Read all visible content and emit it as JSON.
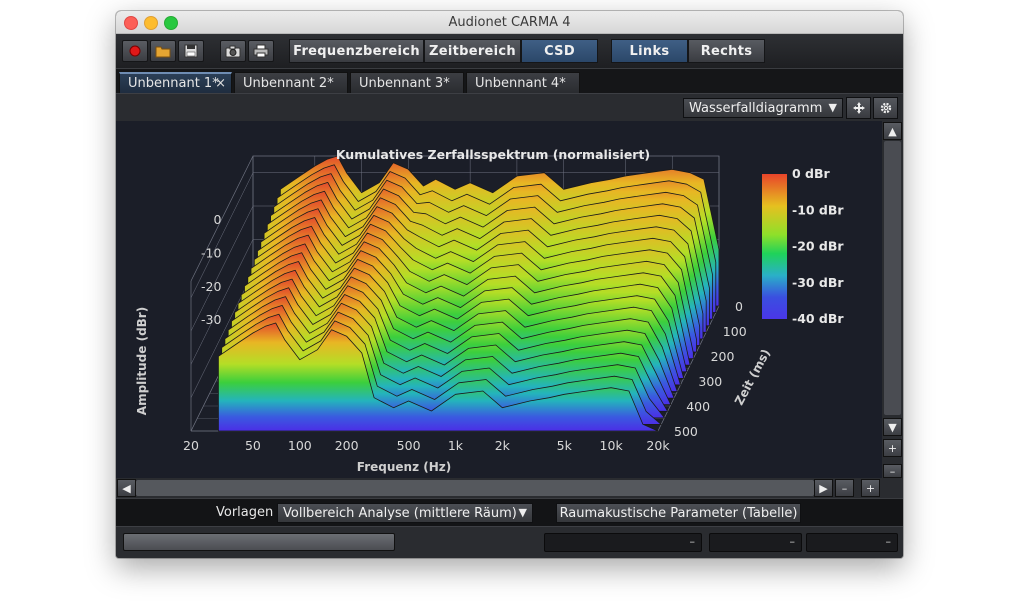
{
  "window": {
    "title": "Audionet CARMA 4"
  },
  "toolbar": {
    "icons": [
      "record-icon",
      "open-folder-icon",
      "save-icon",
      "camera-icon",
      "print-icon"
    ],
    "views": [
      "Frequenzbereich",
      "Zeitbereich",
      "CSD"
    ],
    "active_view": "CSD",
    "channels": [
      "Links",
      "Rechts"
    ],
    "active_channel": "Links",
    "accent": "#2b4769"
  },
  "tabs": [
    {
      "label": "Unbennant 1*",
      "active": true,
      "close": "×"
    },
    {
      "label": "Unbennant 2*"
    },
    {
      "label": "Unbennant 3*"
    },
    {
      "label": "Unbennant 4*"
    }
  ],
  "subbar": {
    "diagram_select": "Wasserfalldiagramm",
    "move_icon": "move-icon",
    "settings_icon": "gear-icon"
  },
  "chart_data": {
    "type": "waterfall",
    "title": "Kumulatives Zerfallsspektrum (normalisiert)",
    "xlabel": "Frequenz (Hz)",
    "ylabel": "Amplitude (dBr)",
    "zlabel": "Zeit (ms)",
    "x_ticks": [
      "20",
      "50",
      "100",
      "200",
      "500",
      "1k",
      "2k",
      "5k",
      "10k",
      "20k"
    ],
    "x_scale": "log",
    "xlim": [
      20,
      20000
    ],
    "y_ticks": [
      "0",
      "-10",
      "-20",
      "-30"
    ],
    "ylim": [
      -40,
      5
    ],
    "z_ticks": [
      "0",
      "100",
      "200",
      "300",
      "400",
      "500"
    ],
    "zlim": [
      0,
      500
    ],
    "colorbar": {
      "labels": [
        "0 dBr",
        "-10 dBr",
        "-20 dBr",
        "-30 dBr",
        "-40 dBr"
      ],
      "colors": [
        "#e8442a",
        "#e6c020",
        "#8ee02a",
        "#1fd25a",
        "#2ab0c8",
        "#3a4fe0",
        "#4a36e8"
      ]
    },
    "front_slice_freqs": [
      30,
      40,
      50,
      60,
      70,
      80,
      100,
      130,
      160,
      200,
      250,
      300,
      400,
      500,
      700,
      1000,
      1500,
      2000,
      3000,
      4000,
      5000,
      7000,
      10000,
      13000,
      16000,
      20000
    ],
    "front_slice_db": [
      -12,
      -8,
      -5,
      -3,
      -2,
      -7,
      -13,
      -10,
      -4,
      -6,
      -11,
      -9,
      -12,
      -10,
      -13,
      -8,
      -7,
      -12,
      -10,
      -9,
      -8,
      -7,
      -6,
      -7,
      -9,
      -30
    ],
    "slice_count": 20
  },
  "bottom": {
    "templates_label": "Vorlagen",
    "templates_value": "Vollbereich Analyse (mittlere Räum)",
    "room_params_button": "Raumakustische Parameter (Tabelle)"
  },
  "status": {
    "fields": [
      "–",
      "–",
      "–"
    ]
  },
  "scroll": {
    "up": "▲",
    "down": "▼",
    "left": "◀",
    "right": "▶",
    "plus": "+",
    "minus": "–"
  }
}
